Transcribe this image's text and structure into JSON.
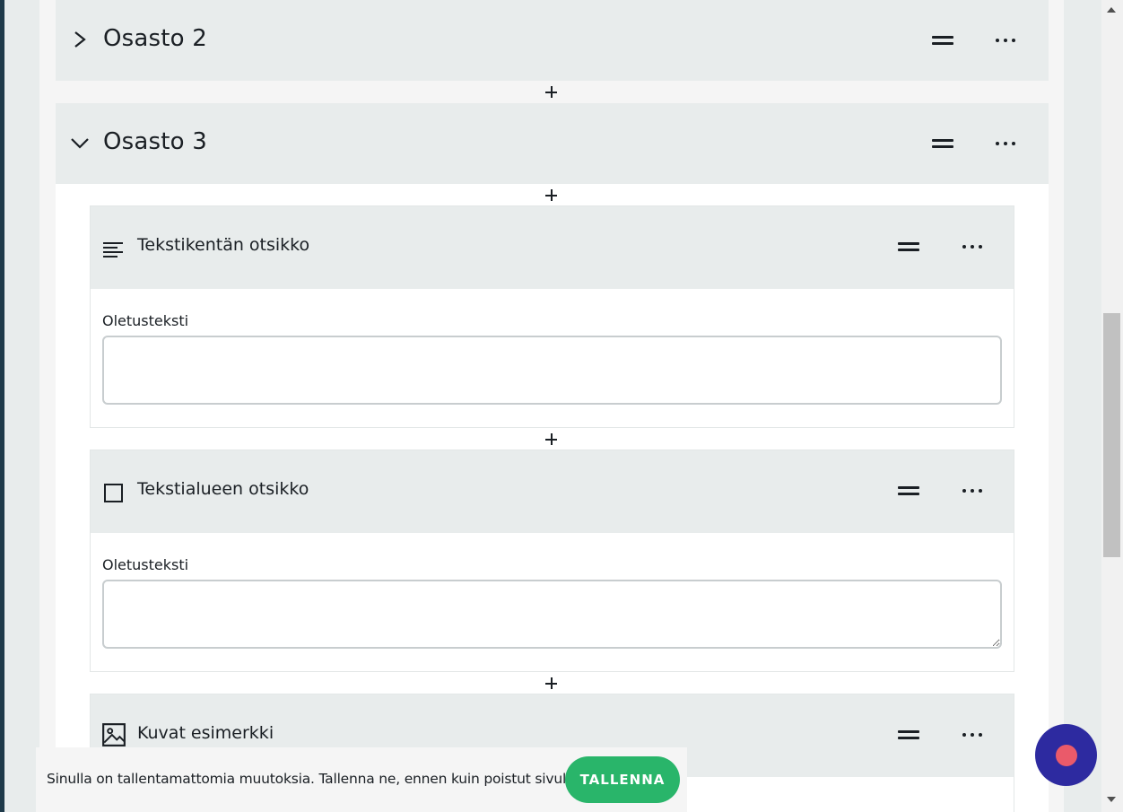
{
  "sections": [
    {
      "title": "Osasto 2",
      "expanded": false
    },
    {
      "title": "Osasto 3",
      "expanded": true
    }
  ],
  "blocks": [
    {
      "icon": "text-lines-icon",
      "title": "Tekstikentän otsikko",
      "field_label": "Oletusteksti",
      "field_value": ""
    },
    {
      "icon": "square-icon",
      "title": "Tekstialueen otsikko",
      "field_label": "Oletusteksti",
      "field_value": ""
    },
    {
      "icon": "image-icon",
      "title": "Kuvat esimerkki"
    }
  ],
  "notice": {
    "text": "Sinulla on tallentamattomia muutoksia. Tallenna ne, ennen kuin poistut sivulta.",
    "save_label": "TALLENNA"
  },
  "colors": {
    "save_button": "#29b56a",
    "fab": "#2d2aa0",
    "fab_dot": "#ea5a6a"
  }
}
